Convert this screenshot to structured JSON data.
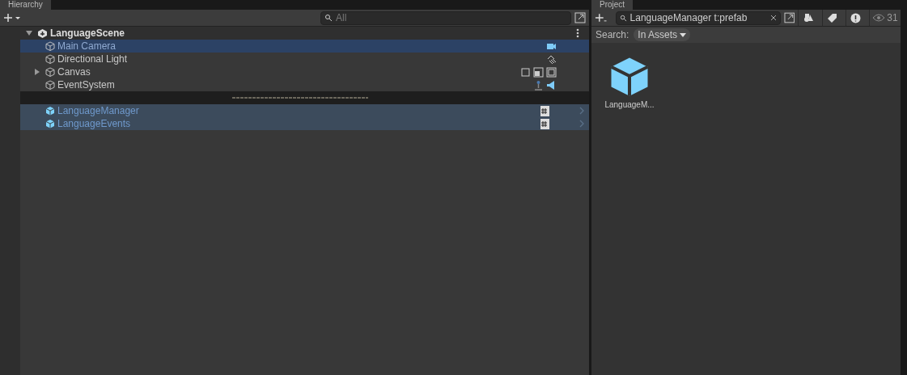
{
  "hierarchy": {
    "title": "Hierarchy",
    "search": {
      "placeholder": "All"
    },
    "scene": {
      "name": "LanguageScene",
      "expanded": true
    },
    "rows": [
      {
        "name": "Main Camera",
        "kind": "object",
        "selected": true,
        "expandable": false,
        "components": [
          {
            "kind": "camera"
          }
        ]
      },
      {
        "name": "Directional Light",
        "kind": "object",
        "selected": false,
        "expandable": false,
        "components": [
          {
            "kind": "light"
          }
        ]
      },
      {
        "name": "Canvas",
        "kind": "object",
        "selected": false,
        "expandable": true,
        "components": [
          {
            "kind": "rect"
          },
          {
            "kind": "canvas-scaler"
          },
          {
            "kind": "frame"
          }
        ]
      },
      {
        "name": "EventSystem",
        "kind": "object",
        "selected": false,
        "expandable": false,
        "components": [
          {
            "kind": "joystick"
          },
          {
            "kind": "speaker"
          }
        ]
      },
      {
        "kind": "separator"
      },
      {
        "name": "LanguageManager",
        "kind": "prefab",
        "selected": false,
        "highlighted": true,
        "expandable": false,
        "components": [
          {
            "kind": "script"
          }
        ]
      },
      {
        "name": "LanguageEvents",
        "kind": "prefab",
        "selected": false,
        "highlighted": true,
        "expandable": false,
        "components": [
          {
            "kind": "script"
          }
        ]
      }
    ]
  },
  "project": {
    "title": "Project",
    "search": {
      "value": "LanguageManager t:prefab"
    },
    "count": "31",
    "search_label": "Search:",
    "scope": "In Assets",
    "assets": [
      {
        "name": "LanguageM...",
        "kind": "prefab"
      }
    ]
  }
}
